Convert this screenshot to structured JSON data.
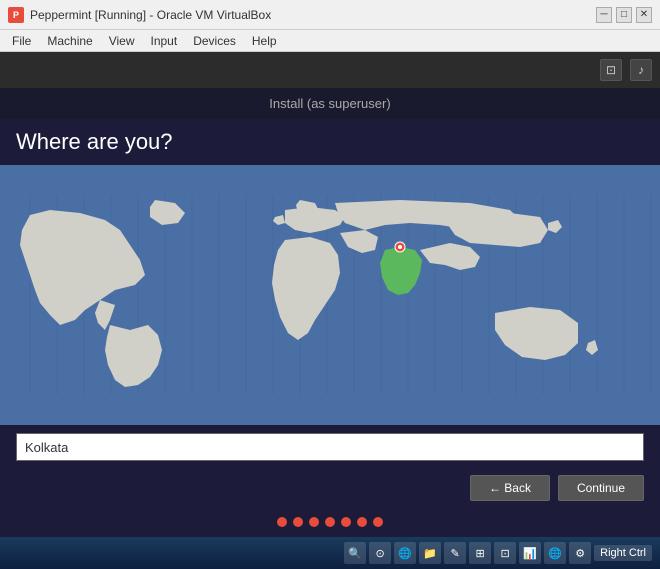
{
  "titlebar": {
    "icon_label": "P",
    "title": "Peppermint [Running] - Oracle VM VirtualBox",
    "minimize_label": "─",
    "restore_label": "□",
    "close_label": "✕"
  },
  "menubar": {
    "items": [
      "File",
      "Machine",
      "View",
      "Input",
      "Devices",
      "Help"
    ]
  },
  "toolbar": {
    "screen_icon": "⊡",
    "audio_icon": "♪"
  },
  "installer": {
    "header": "Install (as superuser)",
    "title": "Where are you?",
    "location": "Kolkata",
    "location_placeholder": "Kolkata"
  },
  "navigation": {
    "back_label": "← Back",
    "continue_label": "Continue"
  },
  "progress": {
    "dots": [
      1,
      2,
      3,
      4,
      5,
      6,
      7
    ]
  },
  "taskbar": {
    "right_ctrl_label": "Right Ctrl"
  }
}
